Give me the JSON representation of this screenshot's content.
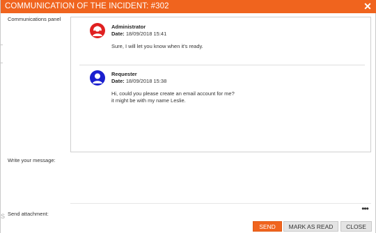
{
  "dialog": {
    "title": "COMMUNICATION OF THE INCIDENT: #302",
    "close_icon": "close-x-icon",
    "accent_color": "#f0641e"
  },
  "labels": {
    "communications_panel": "Communications panel",
    "write_message": "Write your message:",
    "send_attachment": "Send attachment:"
  },
  "messages": [
    {
      "author": "Administrator",
      "date_label": "Date:",
      "date": "18/09/2018 15:41",
      "lines": [
        "Sure, I will let you know when it's ready."
      ],
      "avatar_icon": "admin-avatar-icon",
      "avatar_color": "#e02020"
    },
    {
      "author": "Requester",
      "date_label": "Date:",
      "date": "18/09/2018 15:38",
      "lines": [
        "Hi, could you please create an email account for me?",
        "it might be with my name Leslie."
      ],
      "avatar_icon": "user-avatar-icon",
      "avatar_color": "#1a1fcf"
    }
  ],
  "message_input": {
    "value": "",
    "placeholder": ""
  },
  "attachment": {
    "more_icon": "ellipsis-icon",
    "more_glyph": "•••"
  },
  "buttons": {
    "send": "SEND",
    "mark_as_read": "MARK AS READ",
    "close": "CLOSE"
  },
  "background_fragment": "S"
}
